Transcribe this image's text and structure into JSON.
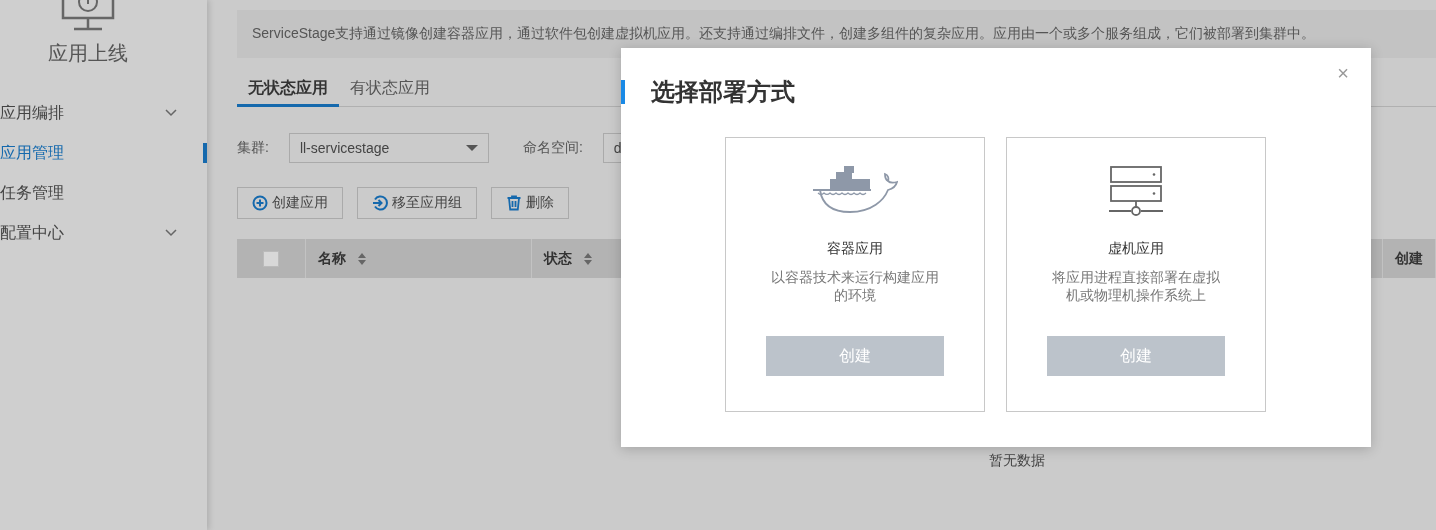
{
  "sidebar": {
    "title": "应用上线",
    "items": [
      {
        "label": "应用编排",
        "expandable": true,
        "selected": false
      },
      {
        "label": "应用管理",
        "expandable": false,
        "selected": true
      },
      {
        "label": "任务管理",
        "expandable": false,
        "selected": false
      },
      {
        "label": "配置中心",
        "expandable": true,
        "selected": false
      }
    ]
  },
  "notice": "ServiceStage支持通过镜像创建容器应用，通过软件包创建虚拟机应用。还支持通过编排文件，创建多组件的复杂应用。应用由一个或多个服务组成，它们被部署到集群中。",
  "tabs": [
    {
      "label": "无状态应用",
      "selected": true
    },
    {
      "label": "有状态应用",
      "selected": false
    }
  ],
  "filters": [
    {
      "label": "集群:",
      "value": "ll-servicestage",
      "dropdown": true
    },
    {
      "label": "命名空间:",
      "value": "d"
    }
  ],
  "actions": [
    {
      "label": "创建应用",
      "kind": "add"
    },
    {
      "label": "移至应用组",
      "kind": "move"
    },
    {
      "label": "删除",
      "kind": "delete"
    }
  ],
  "table": {
    "select_all_checked": false,
    "columns": [
      {
        "label": "名称",
        "sortable": true
      },
      {
        "label": "状态",
        "sortable": true
      },
      {
        "label": "创建",
        "sortable": false
      }
    ],
    "empty_text": "暂无数据"
  },
  "dialog": {
    "title": "选择部署方式",
    "close": "×",
    "options": [
      {
        "kind": "container",
        "title": "容器应用",
        "description": "以容器技术来运行构建应用的环境",
        "button": "创建"
      },
      {
        "kind": "vm",
        "title": "虚机应用",
        "description": "将应用进程直接部署在虚拟机或物理机操作系统上",
        "button": "创建"
      }
    ]
  }
}
